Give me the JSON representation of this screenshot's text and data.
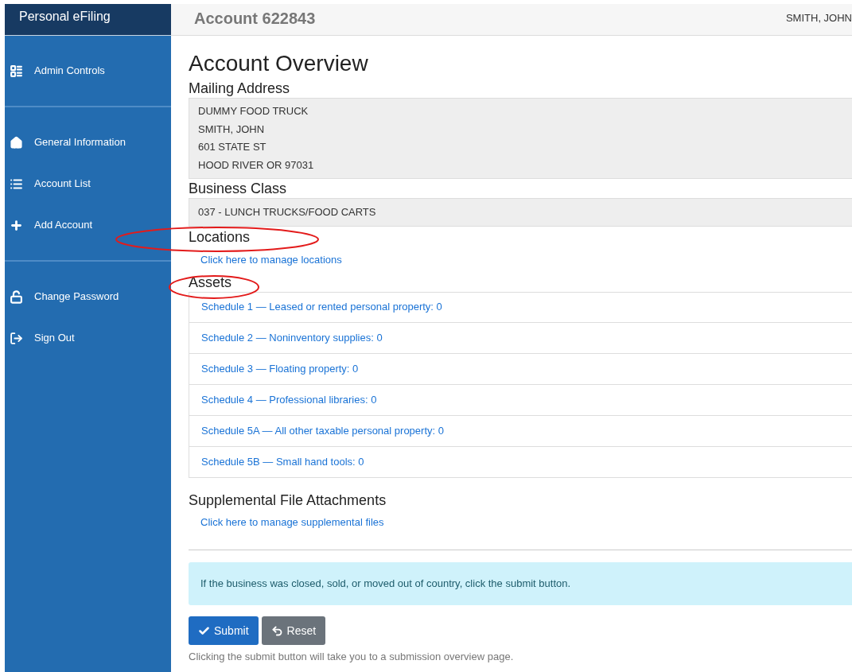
{
  "sidebar": {
    "brand": "Personal eFiling",
    "groups": [
      [
        {
          "kind": "admin",
          "label": "Admin Controls"
        }
      ],
      [
        {
          "kind": "home",
          "label": "General Information"
        },
        {
          "kind": "list",
          "label": "Account List"
        },
        {
          "kind": "plus",
          "label": "Add Account"
        }
      ],
      [
        {
          "kind": "lock",
          "label": "Change Password"
        },
        {
          "kind": "signout",
          "label": "Sign Out"
        }
      ]
    ]
  },
  "header": {
    "title": "Account 622843",
    "user": "SMITH, JOHN"
  },
  "page_title": "Account Overview",
  "mailing_address": {
    "heading": "Mailing Address",
    "lines": [
      "DUMMY FOOD TRUCK",
      "SMITH, JOHN",
      "601 STATE ST",
      "HOOD RIVER OR 97031"
    ]
  },
  "business_class": {
    "heading": "Business Class",
    "value": "037 - LUNCH TRUCKS/FOOD CARTS"
  },
  "locations": {
    "heading": "Locations",
    "link": "Click here to manage locations"
  },
  "assets": {
    "heading": "Assets",
    "schedules": [
      "Schedule 1 — Leased or rented personal property: 0",
      "Schedule 2 — Noninventory supplies: 0",
      "Schedule 3 — Floating property: 0",
      "Schedule 4 — Professional libraries: 0",
      "Schedule 5A — All other taxable personal property: 0",
      "Schedule 5B — Small hand tools: 0"
    ]
  },
  "supplemental": {
    "heading": "Supplemental File Attachments",
    "link": "Click here to manage supplemental files"
  },
  "notice": "If the business was closed, sold, or moved out of country, click the submit button.",
  "buttons": [
    {
      "kind": "primary",
      "label": "Submit"
    },
    {
      "kind": "secondary",
      "label": "Reset"
    }
  ],
  "help_text": "Clicking the submit button will take you to a submission overview page."
}
